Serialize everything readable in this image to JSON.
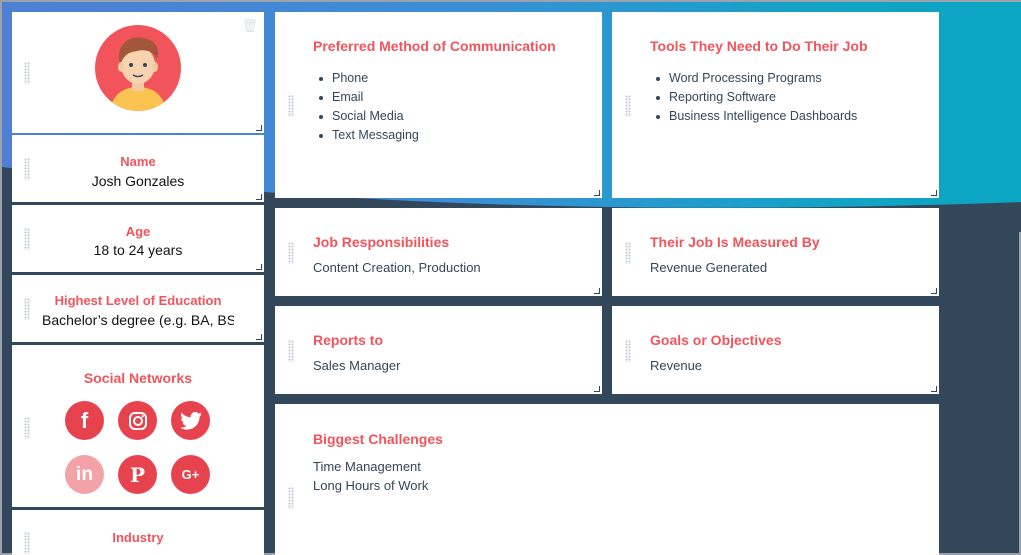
{
  "persona": {
    "name_label": "Name",
    "name_value": "Josh Gonzales",
    "age_label": "Age",
    "age_value": "18 to 24 years",
    "education_label": "Highest Level of Education",
    "education_value": "Bachelor’s degree (e.g. BA, BS",
    "social_label": "Social Networks",
    "social_networks": [
      "facebook",
      "instagram",
      "twitter",
      "linkedin",
      "pinterest",
      "google-plus"
    ],
    "social_glyphs": {
      "facebook": "f",
      "linkedin": "in",
      "pinterest": "P",
      "google_plus": "G+"
    },
    "industry_label": "Industry"
  },
  "cards": {
    "communication": {
      "title": "Preferred Method of Communication",
      "items": [
        "Phone",
        "Email",
        "Social Media",
        "Text Messaging"
      ]
    },
    "tools": {
      "title": "Tools They Need to Do Their Job",
      "items": [
        "Word Processing Programs",
        "Reporting Software",
        "Business Intelligence Dashboards"
      ]
    },
    "responsibilities": {
      "title": "Job Responsibilities",
      "value": "Content Creation, Production"
    },
    "measured": {
      "title": "Their Job Is Measured By",
      "value": "Revenue Generated"
    },
    "reports": {
      "title": "Reports to",
      "value": "Sales Manager"
    },
    "goals": {
      "title": "Goals or Objectives",
      "value": "Revenue"
    },
    "challenges": {
      "title": "Biggest Challenges",
      "lines": [
        "Time Management",
        "Long Hours of Work"
      ]
    }
  },
  "colors": {
    "accent": "#f2545b",
    "text": "#33475b",
    "social_bg": "#e7434f",
    "linkedin_bg": "#f3a3a8",
    "background": "#33475b"
  }
}
